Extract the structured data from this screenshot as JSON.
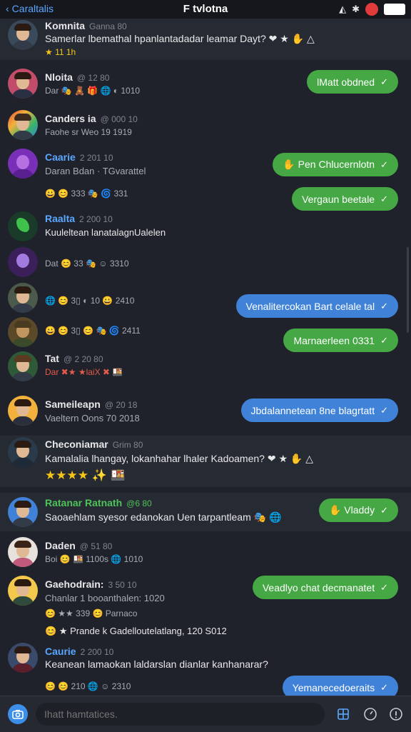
{
  "status_bar": {
    "back_label": "Caraltalis",
    "title": "F tvlotna"
  },
  "colors": {
    "accent": "#5aa7ff",
    "green_bubble": "#45a845",
    "blue_bubble": "#3f82d8",
    "background": "#1f222a"
  },
  "messages": [
    {
      "name": "Komnita",
      "time": "Ganna 80",
      "text": "Samerlar lbemathal hpanlantadadar leamar Dayt? ❤ ★ ✋ △",
      "meta": "★ 11 1h"
    },
    {
      "name": "Nloita",
      "time": "@ 12 80",
      "text": "",
      "meta": "Dar 🎭 🧸 🎁 🌐 ◐ 1010"
    },
    {
      "name": "Canders ia",
      "time": "@ 000 10",
      "text": "",
      "meta": "Faohe sr Weo 19 1919"
    },
    {
      "name": "Caarie",
      "time": "2 201 10",
      "text": "",
      "meta": "Daran Bdan · TGvarattel"
    },
    {
      "name": "",
      "time": "",
      "text": "",
      "meta": "😀 😊 333 🎭 🌀 331"
    },
    {
      "name": "Raalta",
      "time": "2 200 10",
      "text": "Kuuleltean lanatalagnUalelen",
      "meta": ""
    },
    {
      "name": "",
      "time": "",
      "text": "",
      "meta": "Dat 😊 33 🎭 ☺ 3310"
    },
    {
      "name": "",
      "time": "",
      "text": "",
      "meta": "🌐 😊 3▯ ◐ 10 😀 2410"
    },
    {
      "name": "",
      "time": "",
      "text": "",
      "meta": "😀 😊 3▯ 😊 🎭 🌀 2411"
    },
    {
      "name": "Tat",
      "time": "@ 2 20 80",
      "text": "",
      "meta": "Dar ✖★ ★laiX ✖ 🍱"
    },
    {
      "name": "Sameileapn",
      "time": "@ 20 18",
      "text": "",
      "meta": "Vaeltern Oons 70 2018"
    },
    {
      "name": "Checoniamar",
      "time": "Grim 80",
      "text": "Kamalalia lhangay, lokanhahar lhaler Kadoamen? ❤ ★ ✋ △",
      "meta": "★★★★ ✨ 🍱"
    },
    {
      "name": "Ratanar Ratnath",
      "time": "@6 80",
      "text": "Saoaehlam syesor edanokan Uen tarpantleam 🎭 🌐",
      "meta": ""
    },
    {
      "name": "Daden",
      "time": "@ 51 80",
      "text": "",
      "meta": "Boi 😊 🍱 1100s 🌐 1010"
    },
    {
      "name": "Gaehodrain:",
      "time": "3 50 10",
      "text": "",
      "meta": "Chanlar 1 booanthalen: 1020"
    },
    {
      "name": "",
      "time": "",
      "text": "",
      "meta": "😊 ★★ 339 😊 Parnaco"
    },
    {
      "name": "",
      "time": "",
      "text": "",
      "meta": "😊 ★ Prande k Gadelloutelatlang, 120 S012"
    },
    {
      "name": "Caurie",
      "time": "2 200 10",
      "text": "Keanean lamaokan laldarslan dianlar kanhanarar?",
      "meta": ""
    },
    {
      "name": "",
      "time": "",
      "text": "",
      "meta": "😊 😊 210 🌐 ☺ 2310"
    }
  ],
  "bubbles": [
    {
      "text": "lMatt obdned",
      "color": "green",
      "check": "✓"
    },
    {
      "text": "✋ Pen Chlucernlotn",
      "color": "green",
      "check": "✓"
    },
    {
      "text": "Vergaun beetale",
      "color": "green",
      "check": "✓"
    },
    {
      "text": "Venalitercokan Bart celale tal",
      "color": "blue",
      "check": "✓"
    },
    {
      "text": "Marnaerleen 0331",
      "color": "green",
      "check": "✓"
    },
    {
      "text": "Jbdalannetean 8ne blagrtatt",
      "color": "blue",
      "check": "✓"
    },
    {
      "text": "✋ Vladdy",
      "color": "green",
      "check": "✓"
    },
    {
      "text": "Veadlyo chat decmanatet",
      "color": "green",
      "check": "✓"
    },
    {
      "text": "Yemanecedoeraits",
      "color": "blue",
      "check": "✓"
    }
  ],
  "composer": {
    "placeholder": "Ihatt hamtatices."
  }
}
